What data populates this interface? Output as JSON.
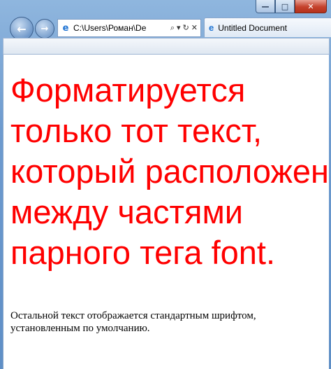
{
  "window": {
    "minimize_label": "—",
    "maximize_label": "□",
    "close_label": "✕"
  },
  "toolbar": {
    "back_glyph": "←",
    "forward_glyph": "→",
    "address_icon": "ie-page-icon",
    "address_value": "C:\\Users\\Роман\\De",
    "search_glyph": "⌕",
    "dropdown_glyph": "▾",
    "refresh_glyph": "↻",
    "stop_glyph": "✕"
  },
  "tab": {
    "icon": "ie-icon",
    "title": "Untitled Document"
  },
  "page": {
    "big_text": "Форматируется только тот текст, который расположен между частями парного тега font.",
    "big_color": "#ff0000",
    "small_text": "Остальной текст отображается стандартным шрифтом, установленным по умолчанию."
  }
}
